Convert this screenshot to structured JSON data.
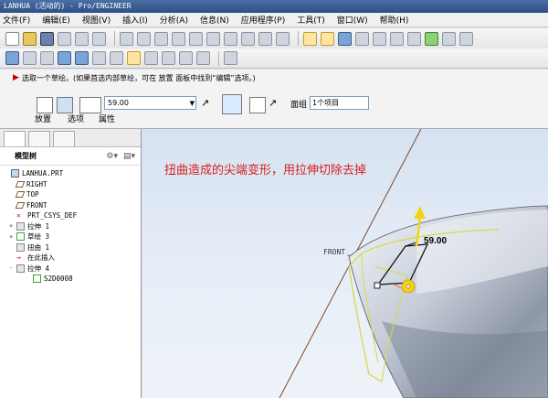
{
  "window": {
    "title": "LANHUA (活动的) - Pro/ENGINEER"
  },
  "menu": [
    "文件(F)",
    "编辑(E)",
    "视图(V)",
    "插入(I)",
    "分析(A)",
    "信息(N)",
    "应用程序(P)",
    "工具(T)",
    "窗口(W)",
    "帮助(H)"
  ],
  "dashboard": {
    "prompt": "选取一个草绘。(如果首选内部草绘，可在 放置 面板中找到“编辑”选项。)",
    "depth_value": "59.00",
    "thicken_label": "面组",
    "thicken_value": "1个项目",
    "tabs": [
      "放置",
      "选项",
      "属性"
    ]
  },
  "model_tree": {
    "title": "模型树",
    "items": [
      {
        "label": "LANHUA.PRT",
        "icon": "part-icon",
        "indent": 0
      },
      {
        "label": "RIGHT",
        "icon": "datum-plane-icon",
        "indent": 1
      },
      {
        "label": "TOP",
        "icon": "datum-plane-icon",
        "indent": 1
      },
      {
        "label": "FRONT",
        "icon": "datum-plane-icon",
        "indent": 1
      },
      {
        "label": "PRT_CSYS_DEF",
        "icon": "csys-icon",
        "indent": 1
      },
      {
        "label": "拉伸 1",
        "icon": "extrude-icon",
        "indent": 1,
        "expander": "+"
      },
      {
        "label": "草绘 3",
        "icon": "sketch-icon",
        "indent": 1,
        "expander": "+"
      },
      {
        "label": "扭曲 1",
        "icon": "warp-icon",
        "indent": 1
      },
      {
        "label": "在此插入",
        "icon": "insert-here-icon",
        "indent": 1
      },
      {
        "label": "拉伸 4",
        "icon": "extrude-icon",
        "indent": 1,
        "expander": "-"
      },
      {
        "label": "S2D0008",
        "icon": "sketch-icon",
        "indent": 2
      }
    ]
  },
  "viewport": {
    "annotation": "扭曲造成的尖端变形，用拉伸切除去掉",
    "datum_label": "FRONT",
    "dimension": "59.00"
  },
  "colors": {
    "annotation": "#d61e1e",
    "sketch_yellow": "#d8d84a",
    "arrow_yellow": "#f2d21a",
    "background": "#d6e2f1"
  }
}
